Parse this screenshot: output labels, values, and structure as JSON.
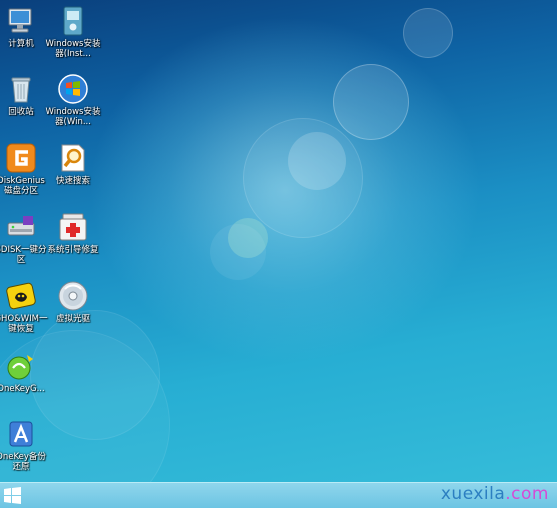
{
  "desktop": {
    "icons": [
      {
        "label": "计算机",
        "icon": "computer-icon"
      },
      {
        "label": "Windows安装器(Inst...",
        "icon": "installer-icon"
      },
      {
        "label": "回收站",
        "icon": "recycle-bin-icon"
      },
      {
        "label": "Windows安装器(Win...",
        "icon": "windows-logo-icon"
      },
      {
        "label": "DiskGenius磁盘分区",
        "icon": "diskgenius-icon"
      },
      {
        "label": "快速搜索",
        "icon": "search-icon"
      },
      {
        "label": "SDISK一键分区",
        "icon": "sdisk-icon"
      },
      {
        "label": "系统引导修复",
        "icon": "first-aid-icon"
      },
      {
        "label": "GHO&WIM一键恢复",
        "icon": "ghost-icon"
      },
      {
        "label": "虚拟光驱",
        "icon": "cd-icon"
      },
      {
        "label": "OneKeyG...",
        "icon": "onekey-ghost-icon"
      },
      {
        "label": "OneKey备份还原",
        "icon": "onekey-backup-icon"
      }
    ]
  },
  "taskbar": {
    "start_icon": "windows-start-icon",
    "watermark_a": "xuexila",
    "watermark_b": ".com"
  },
  "colors": {
    "wallpaper_top": "#0a3f7c",
    "wallpaper_bottom": "#35bcd9",
    "taskbar": "#7ccde8",
    "watermark_a": "#2c7fc1",
    "watermark_b": "#d64bd6"
  }
}
